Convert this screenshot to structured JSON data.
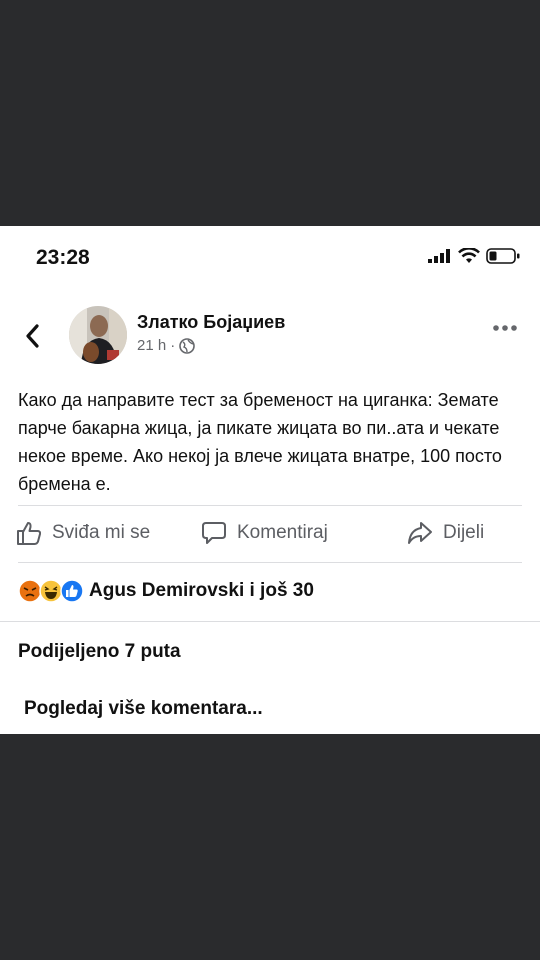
{
  "status_bar": {
    "time": "23:28"
  },
  "post": {
    "author": "Златко Бојаџиев",
    "time": "21 h",
    "separator": "·",
    "text": "Како да направите тест за бременост на циганка: Земате парче бакарна жица, ја пикате жицата во пи..ата и чекате некое време. Ако некој ја влече жицата внатре, 100 посто бремена е."
  },
  "actions": {
    "like": "Sviđa mi se",
    "comment": "Komentiraj",
    "share": "Dijeli"
  },
  "reactions": {
    "icons": [
      "angry-emoji-icon",
      "laugh-emoji-icon",
      "like-emoji-icon"
    ],
    "label": "Agus Demirovski i još 30"
  },
  "shares": "Podijeljeno 7 puta",
  "more_comments": "Pogledaj više komentara...",
  "colors": {
    "background": "#2a2b2d",
    "surface": "#ffffff",
    "text": "#111111",
    "secondary": "#65676b",
    "like_blue": "#1877f2"
  }
}
